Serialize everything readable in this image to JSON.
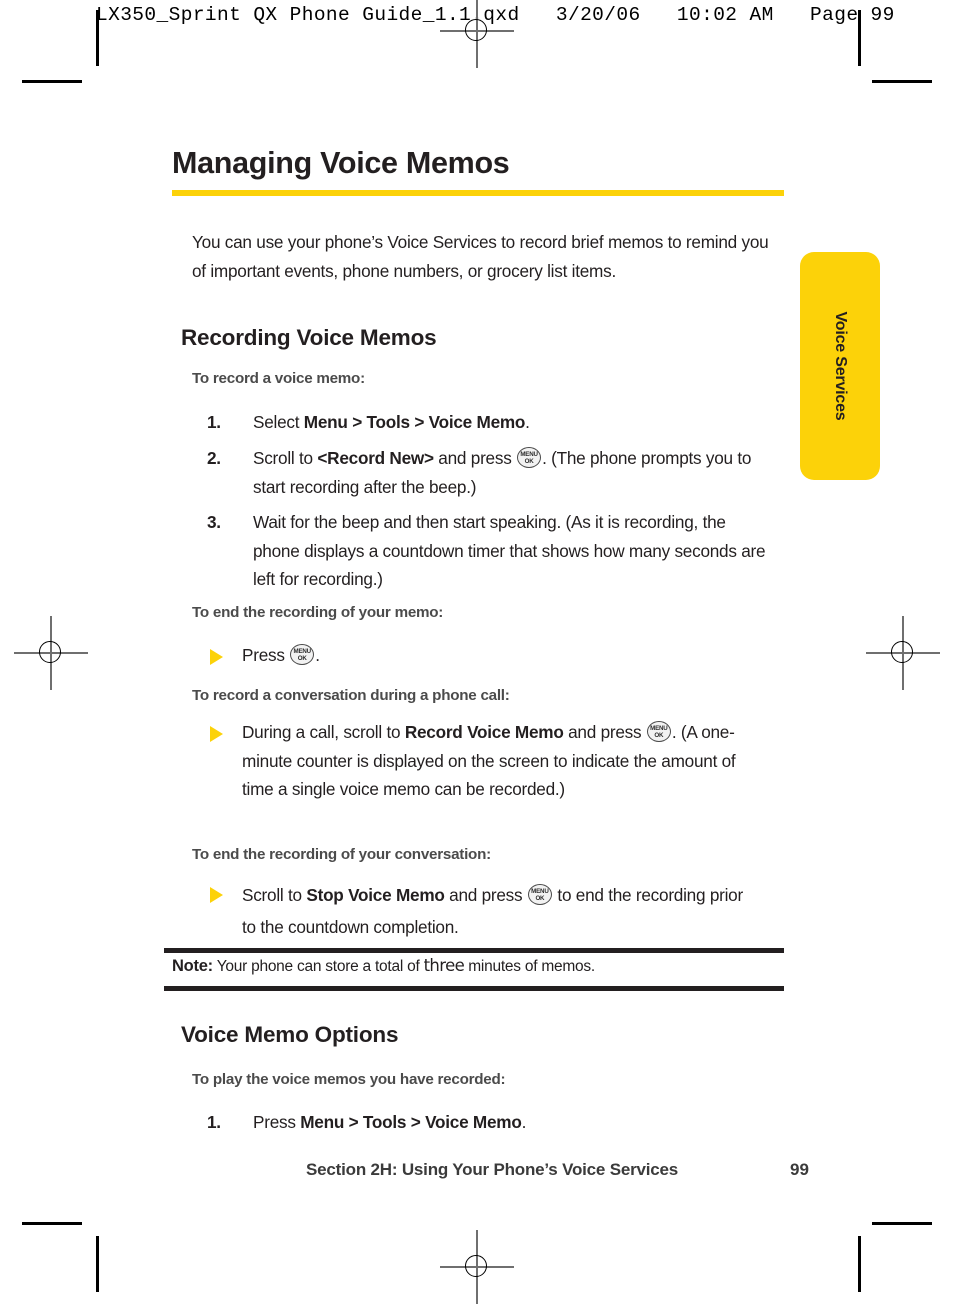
{
  "prepress": {
    "header_line": "LX350_Sprint QX Phone Guide_1.1.qxd   3/20/06   10:02 AM   Page 99"
  },
  "page": {
    "chapter_title": "Managing Voice Memos",
    "intro": "You can use your phone’s Voice Services to record brief memos to remind you of important events, phone numbers, or grocery list items.",
    "sections": [
      {
        "heading": "Recording Voice Memos",
        "lead_1": "To record a voice memo:",
        "step_1_pre": "Select ",
        "step_1_bold": "Menu > Tools > Voice Memo",
        "step_1_post": ".",
        "step_1_num": "1.",
        "step_2_num": "2.",
        "step_2_pre": "Scroll to ",
        "step_2_bold": "<Record New>",
        "step_2_mid": " and press ",
        "step_2_post": ". (The phone prompts you to start recording after the beep.)",
        "step_3_num": "3.",
        "step_3_text": "Wait for the beep and then start speaking. (As it is recording, the phone displays a countdown timer that shows how many seconds are left for recording.)",
        "lead_2": "To end the recording of your memo:",
        "bullet_1_pre": "Press ",
        "bullet_1_post": ".",
        "lead_3": "To record a conversation during a phone call:",
        "bullet_2_pre": "During a call, scroll to ",
        "bullet_2_bold": "Record Voice Memo",
        "bullet_2_mid": " and press ",
        "bullet_2_post": ". (A one-minute counter is displayed on the screen to  indicate the amount of time a single voice memo can be recorded.)",
        "lead_4": "To end the recording of your conversation:",
        "bullet_3_pre": "Scroll to ",
        "bullet_3_bold": "Stop Voice Memo",
        "bullet_3_mid": " and press ",
        "bullet_3_post": " to end the recording prior to the countdown completion."
      },
      {
        "heading": "Voice Memo Options",
        "lead_1": "To play the voice memos you have recorded:",
        "step_1_num": "1.",
        "step_1_pre": "Press ",
        "step_1_bold": "Menu > Tools > Voice Memo",
        "step_1_post": "."
      }
    ],
    "note": {
      "label": "Note:",
      "text_before": " Your phone can store a total of ",
      "emphasis": "three",
      "text_after": " minutes of memos."
    },
    "footer": {
      "section": "Section 2H: Using Your Phone’s Voice Services",
      "page_number": "99"
    },
    "side_tab": {
      "label": "Voice Services"
    },
    "icons": {
      "menu_key_line1": "MENU",
      "menu_key_line2": "OK"
    },
    "colors": {
      "accent_yellow": "#fcd209",
      "text": "#231f20",
      "lead_gray": "#4b4b4b"
    }
  }
}
